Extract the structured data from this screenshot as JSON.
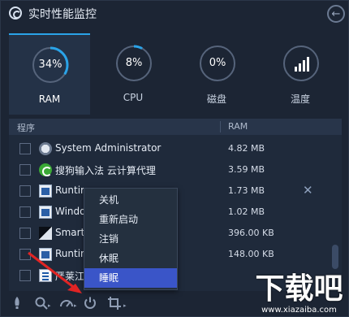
{
  "app": {
    "title": "实时性能监控",
    "back_glyph": "←"
  },
  "gauges": [
    {
      "label": "RAM",
      "value": "34%",
      "percent": 34,
      "active": true
    },
    {
      "label": "CPU",
      "value": "8%",
      "percent": 8,
      "active": false
    },
    {
      "label": "磁盘",
      "value": "0%",
      "percent": 0,
      "active": false
    },
    {
      "label": "温度",
      "icon": "bar-chart-icon",
      "active": false
    }
  ],
  "colors": {
    "accent": "#2aa3e8",
    "ring_track": "#56647b",
    "menu_highlight": "#3a55c8",
    "annotation": "#e02424"
  },
  "table": {
    "col_name": "程序",
    "col_ram": "RAM",
    "rows": [
      {
        "name": "System Administrator",
        "ram": "4.82 MB",
        "icon": "admin-icon"
      },
      {
        "name": "搜狗输入法 云计算代理",
        "ram": "3.59 MB",
        "icon": "sogou-icon"
      },
      {
        "name": "Runtim",
        "ram": "1.73 MB",
        "icon": "window-icon",
        "close": "✕"
      },
      {
        "name": "Windo",
        "ram": "1.02 MB",
        "icon": "window-icon"
      },
      {
        "name": "Smart N",
        "ram": "396.00 KB",
        "icon": "smart-icon"
      },
      {
        "name": "Runtim",
        "ram": "148.00 KB",
        "icon": "window-icon"
      },
      {
        "name": "严莱江",
        "ram": "",
        "icon": "doc-icon"
      }
    ]
  },
  "context_menu": {
    "items": [
      "关机",
      "重新启动",
      "注销",
      "休眠",
      "睡眠"
    ],
    "highlighted": "睡眠"
  },
  "toolbar": {
    "icons": [
      "rocket-icon",
      "search-icon",
      "speedometer-icon",
      "power-icon",
      "crop-icon"
    ]
  },
  "watermark": {
    "big": "下载吧",
    "small": "www.xiazaiba.com"
  }
}
